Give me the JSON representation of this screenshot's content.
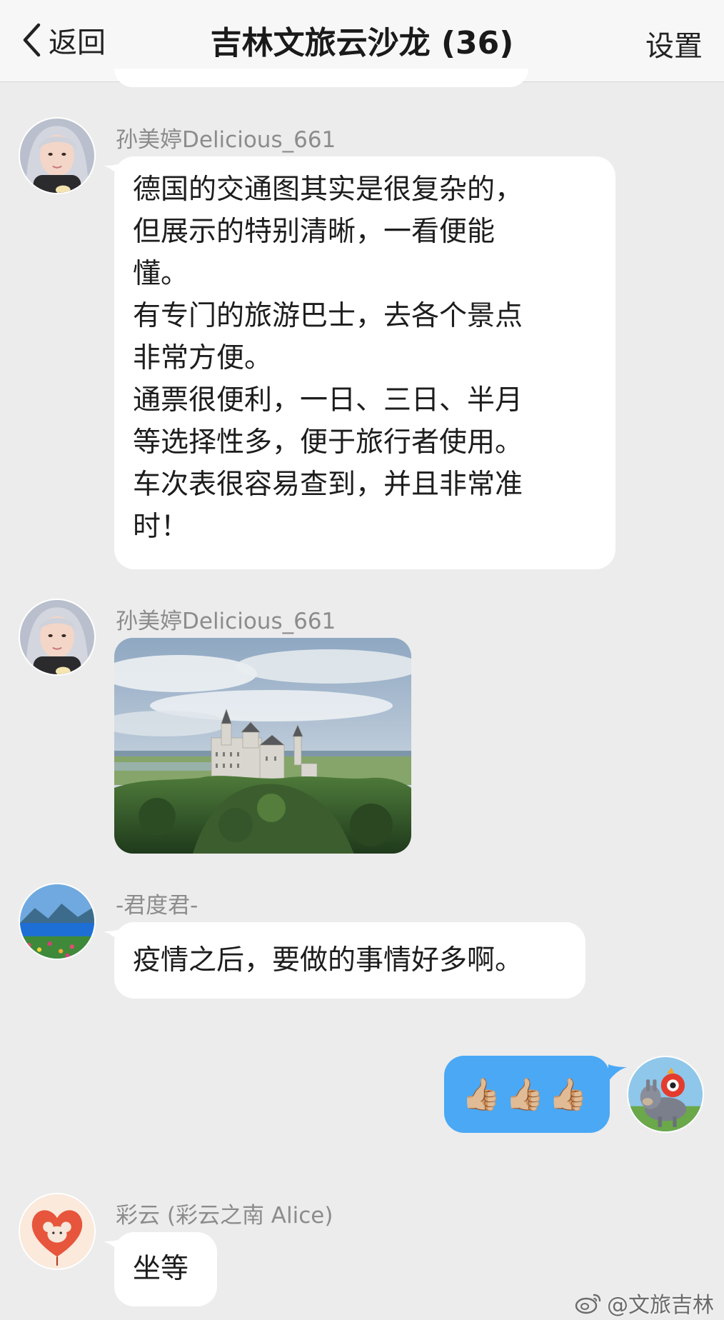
{
  "nav": {
    "back_label": "返回",
    "title": "吉林文旅云沙龙 (36)",
    "settings_label": "设置"
  },
  "messages": [
    {
      "sender": "孙美婷Delicious_661",
      "type": "text",
      "lines": [
        "德国的交通图其实是很复杂的，",
        "但展示的特别清晰，一看便能",
        "懂。",
        "有专门的旅游巴士，去各个景点",
        "非常方便。",
        "通票很便利，一日、三日、半月",
        "等选择性多，便于旅行者使用。",
        "车次表很容易查到，并且非常准",
        "时！"
      ]
    },
    {
      "sender": "孙美婷Delicious_661",
      "type": "image"
    },
    {
      "sender": "-君度君-",
      "type": "text",
      "lines": [
        "疫情之后，要做的事情好多啊。"
      ]
    },
    {
      "sender": "",
      "type": "outgoing",
      "text": "👍🏼👍🏼👍🏼"
    },
    {
      "sender": "彩云 (彩云之南 Alice)",
      "type": "text",
      "lines": [
        "坐等"
      ]
    }
  ],
  "watermark": "@文旅吉林",
  "colors": {
    "nav_bg": "#f7f7f7",
    "chat_bg": "#ececec",
    "incoming_bubble": "#ffffff",
    "outgoing_bubble": "#4aa8f5",
    "sender_text": "#8c8c8c"
  }
}
